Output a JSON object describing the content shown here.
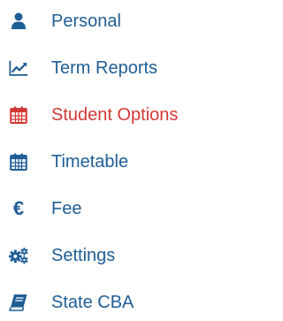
{
  "colors": {
    "default": "#1f5e96",
    "active": "#d33a36"
  },
  "menu": {
    "items": [
      {
        "label": "Personal",
        "icon": "user-icon",
        "active": false
      },
      {
        "label": "Term Reports",
        "icon": "line-chart-icon",
        "active": false
      },
      {
        "label": "Student Options",
        "icon": "calendar-icon",
        "active": true
      },
      {
        "label": "Timetable",
        "icon": "calendar-icon",
        "active": false
      },
      {
        "label": "Fee",
        "icon": "euro-icon",
        "active": false
      },
      {
        "label": "Settings",
        "icon": "cogs-icon",
        "active": false
      },
      {
        "label": "State CBA",
        "icon": "book-icon",
        "active": false
      }
    ]
  }
}
